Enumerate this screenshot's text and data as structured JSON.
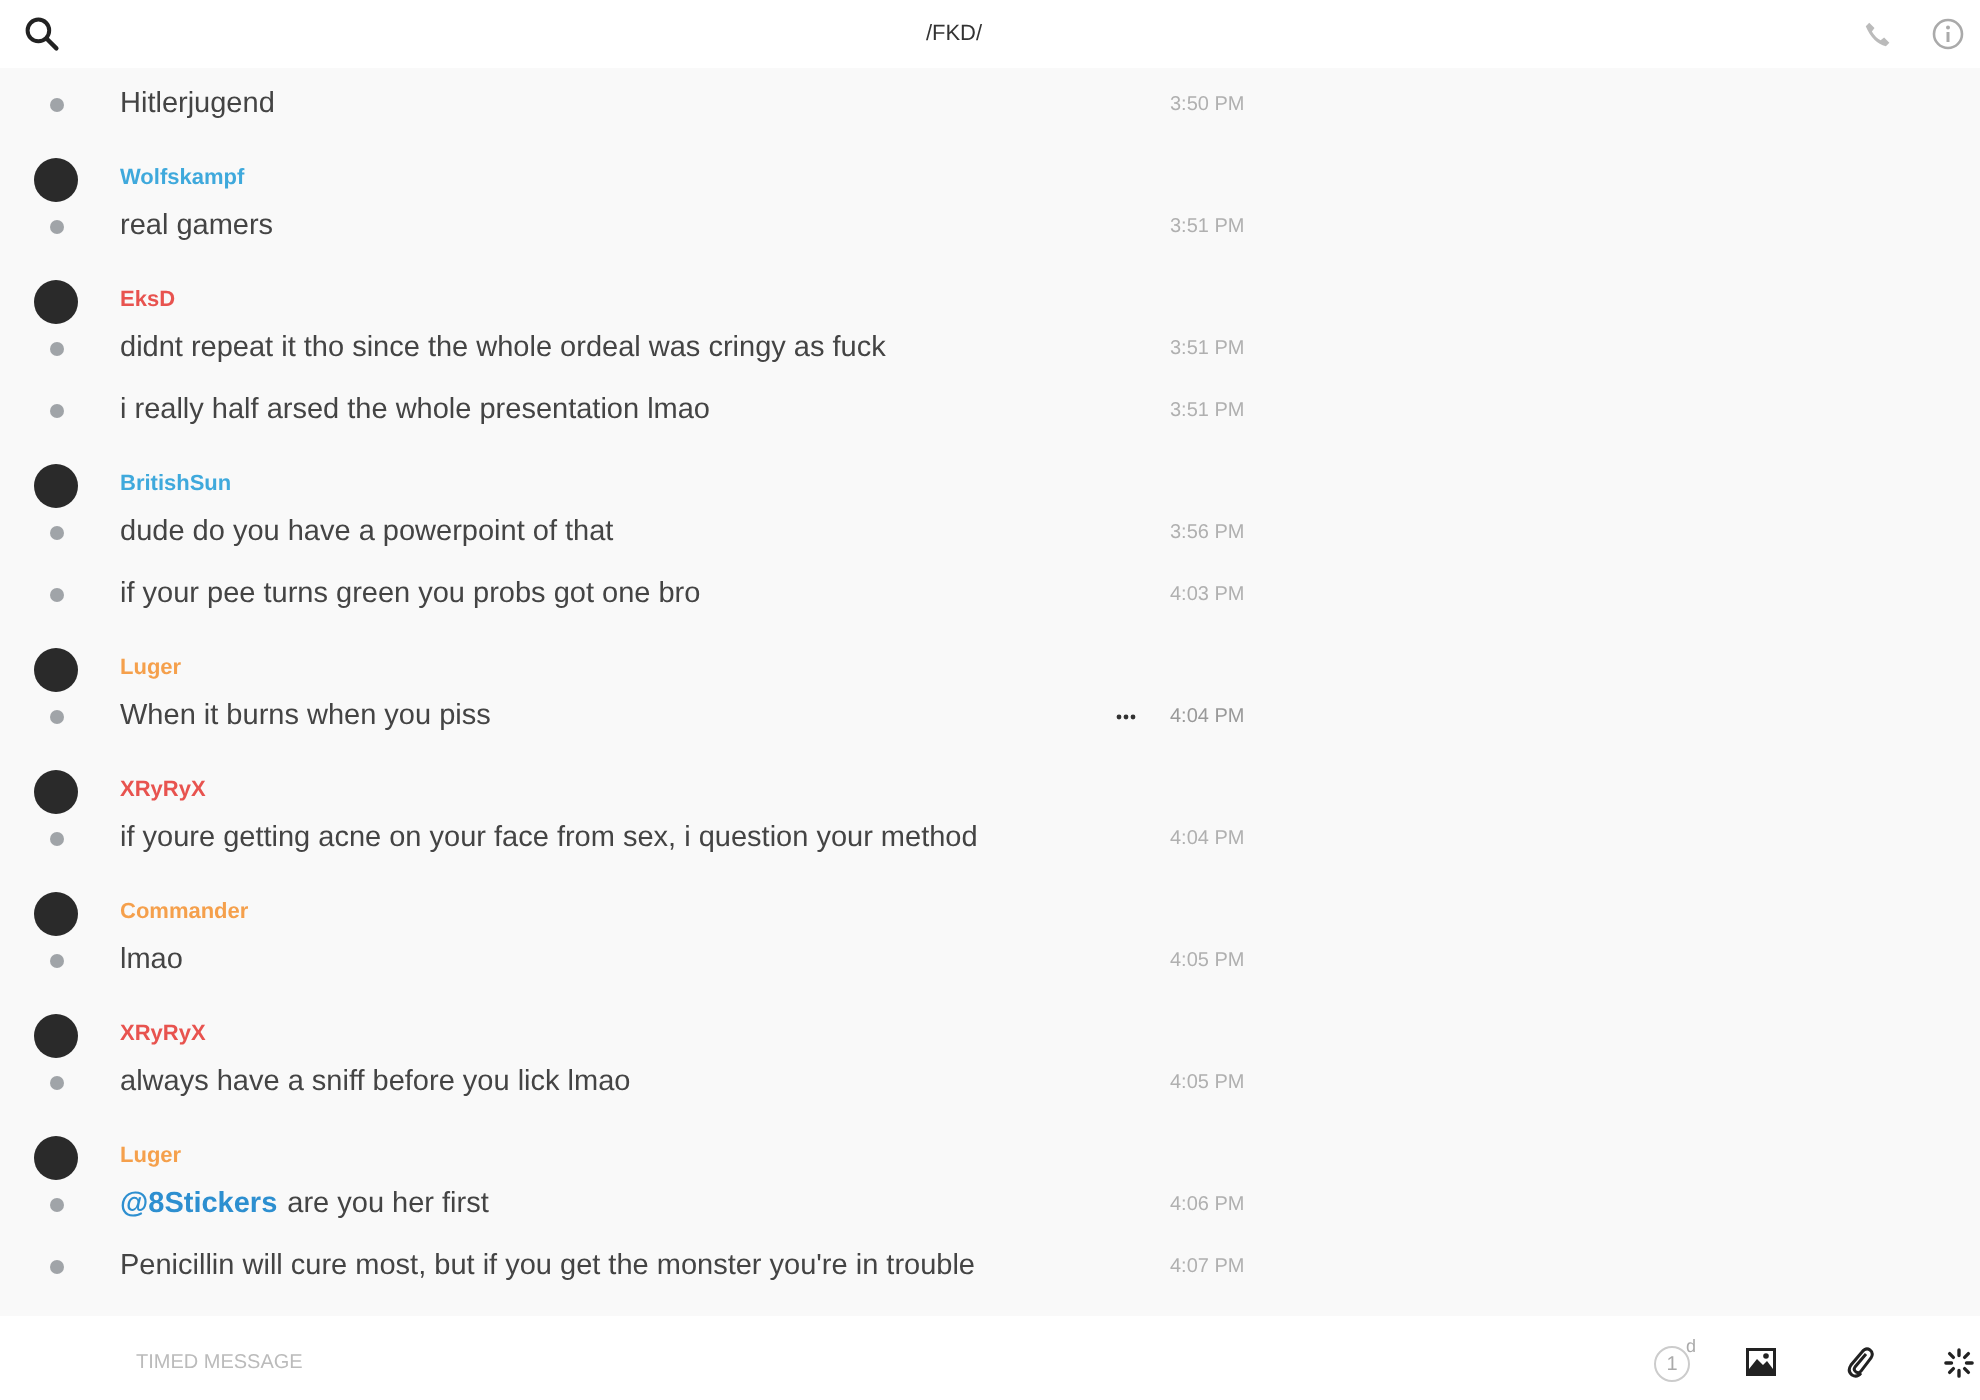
{
  "header": {
    "title": "/FKD/"
  },
  "groups": [
    {
      "messages": [
        {
          "text": "Hitlerjugend",
          "time": "3:50 PM",
          "hovered": false
        }
      ]
    },
    {
      "author": "Wolfskampf",
      "color": "#3fa9dc",
      "messages": [
        {
          "text": "real gamers",
          "time": "3:51 PM",
          "hovered": false
        }
      ]
    },
    {
      "author": "EksD",
      "color": "#e8534f",
      "messages": [
        {
          "text": "didnt repeat it tho since the whole ordeal was cringy as fuck",
          "time": "3:51 PM",
          "hovered": false
        },
        {
          "text": "i really half arsed the whole presentation lmao",
          "time": "3:51 PM",
          "hovered": false
        }
      ]
    },
    {
      "author": "BritishSun",
      "color": "#3fa9dc",
      "messages": [
        {
          "text": "dude do you have a powerpoint of that",
          "time": "3:56 PM",
          "hovered": false
        },
        {
          "text": "if your pee turns green you probs got one bro",
          "time": "4:03 PM",
          "hovered": false
        }
      ]
    },
    {
      "author": "Luger",
      "color": "#f5a04c",
      "messages": [
        {
          "text": "When it burns when you piss",
          "time": "4:04 PM",
          "hovered": true
        }
      ]
    },
    {
      "author": "XRyRyX",
      "color": "#e8534f",
      "messages": [
        {
          "text": "if youre getting acne on your face from sex, i question your method",
          "time": "4:04 PM",
          "hovered": false
        }
      ]
    },
    {
      "author": "Commander",
      "color": "#f5a04c",
      "messages": [
        {
          "text": "lmao",
          "time": "4:05 PM",
          "hovered": false
        }
      ]
    },
    {
      "author": "XRyRyX",
      "color": "#e8534f",
      "messages": [
        {
          "text": "always have a sniff before you lick lmao",
          "time": "4:05 PM",
          "hovered": false
        }
      ]
    },
    {
      "author": "Luger",
      "color": "#f5a04c",
      "messages": [
        {
          "mention": "@8Stickers",
          "text": "are you her first",
          "time": "4:06 PM",
          "hovered": false
        },
        {
          "text": "Penicillin will cure most, but if you get the monster you're in trouble",
          "time": "4:07 PM",
          "hovered": false
        }
      ]
    }
  ],
  "composer": {
    "placeholder": "TIMED MESSAGE",
    "timer_value": "1",
    "timer_unit": "d"
  }
}
